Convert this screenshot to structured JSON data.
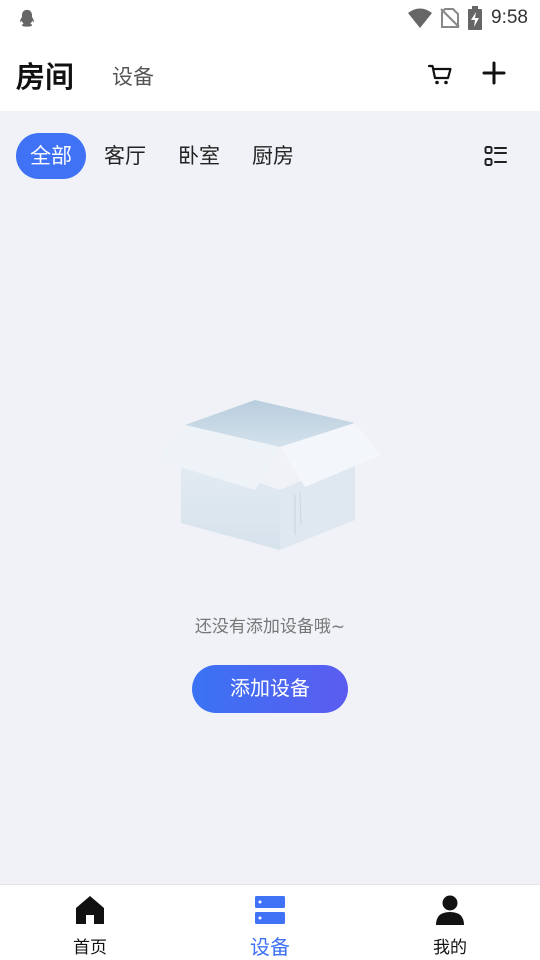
{
  "status_bar": {
    "time": "9:58",
    "icons": [
      "qq-icon",
      "wifi-icon",
      "no-sim-icon",
      "battery-charging-icon"
    ]
  },
  "header": {
    "title": "房间",
    "tab": "设备",
    "icons": [
      "cart-icon",
      "plus-icon"
    ]
  },
  "room_tabs": [
    {
      "label": "全部",
      "active": true
    },
    {
      "label": "客厅",
      "active": false
    },
    {
      "label": "卧室",
      "active": false
    },
    {
      "label": "厨房",
      "active": false
    }
  ],
  "empty_state": {
    "icon": "empty-box-icon",
    "message": "还没有添加设备哦~",
    "button_label": "添加设备"
  },
  "bottom_nav": {
    "items": [
      {
        "label": "首页",
        "icon": "home-icon",
        "active": false
      },
      {
        "label": "设备",
        "icon": "device-icon",
        "active": true
      },
      {
        "label": "我的",
        "icon": "profile-icon",
        "active": false
      }
    ]
  },
  "colors": {
    "accent": "#3f72f5",
    "background": "#f0f2f7",
    "button_gradient_end": "#5b5cf0"
  }
}
